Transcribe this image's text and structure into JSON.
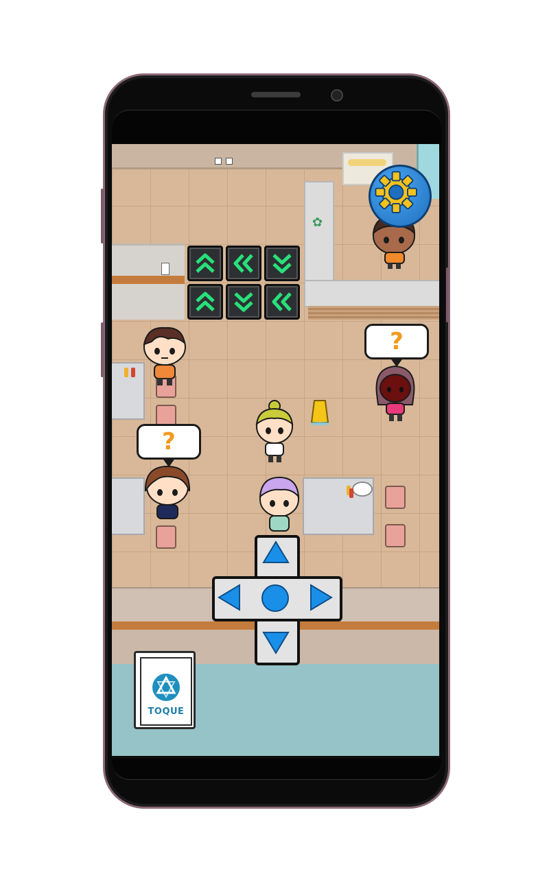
{
  "hud": {
    "settings_icon": "gear-icon",
    "store_button": {
      "label": "TOQUE",
      "icon": "toque-logo-icon"
    }
  },
  "arrow_panel": {
    "row1": [
      "up",
      "left",
      "down"
    ],
    "row2": [
      "up",
      "down",
      "left"
    ]
  },
  "speech_bubbles": [
    "?",
    "?"
  ],
  "dpad": {
    "buttons": [
      "up",
      "left",
      "center",
      "right",
      "down"
    ],
    "color": "#1a8fe8"
  },
  "colors": {
    "accent": "#1a8fe8",
    "bubble_text": "#f29a1f",
    "arrow_green": "#28e07a"
  }
}
